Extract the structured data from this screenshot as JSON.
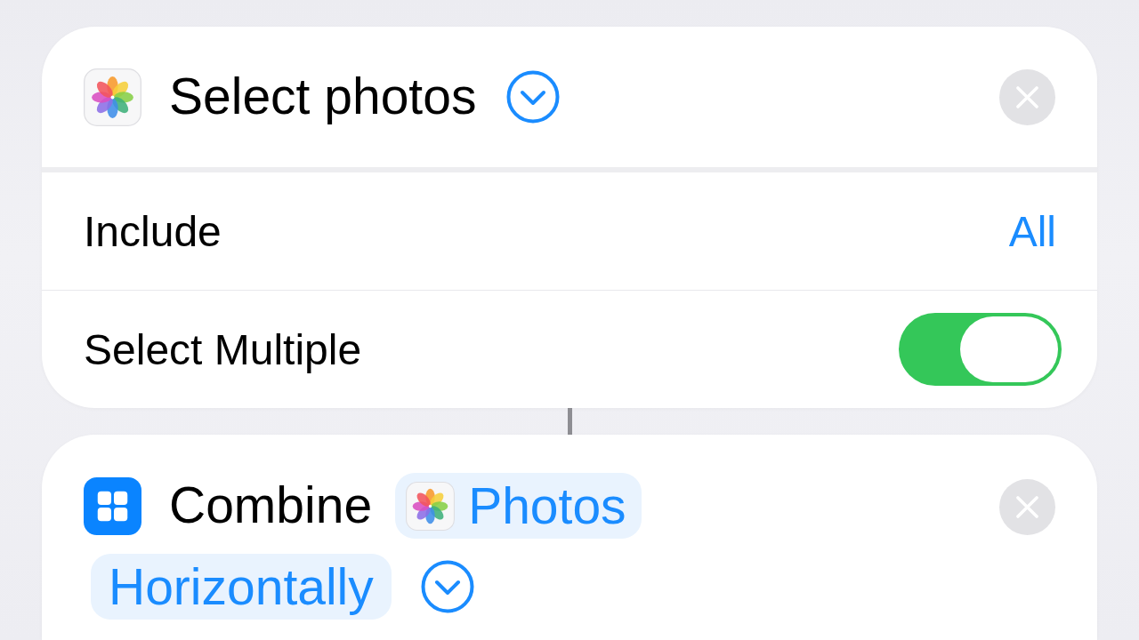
{
  "actions": [
    {
      "kind": "photos",
      "title": "Select photos",
      "expanded": false,
      "rows": [
        {
          "kind": "value",
          "label": "Include",
          "value": "All"
        },
        {
          "kind": "toggle",
          "label": "Select Multiple",
          "on": true
        }
      ]
    },
    {
      "kind": "combine",
      "expanded": false,
      "parts": [
        {
          "kind": "text",
          "text": "Combine"
        },
        {
          "kind": "variable",
          "text": "Photos"
        },
        {
          "kind": "option",
          "text": "Horizontally"
        }
      ]
    }
  ]
}
